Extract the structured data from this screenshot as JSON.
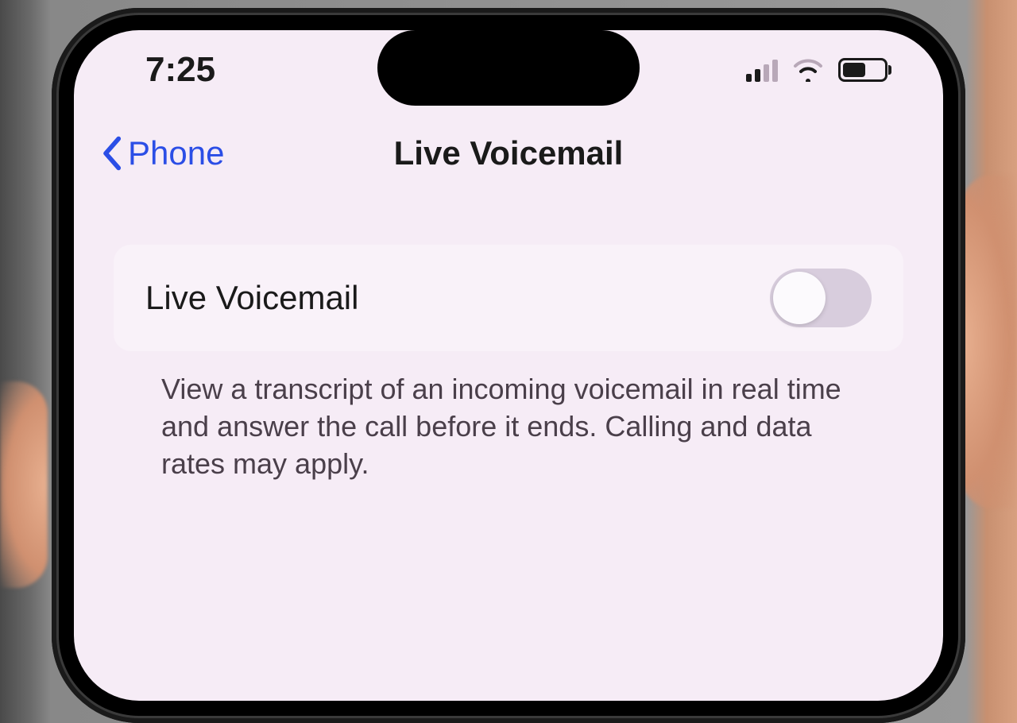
{
  "statusBar": {
    "time": "7:25"
  },
  "nav": {
    "backLabel": "Phone",
    "title": "Live Voicemail"
  },
  "settings": {
    "liveVoicemail": {
      "label": "Live Voicemail",
      "enabled": false,
      "description": "View a transcript of an incoming voicemail in real time and answer the call before it ends. Calling and data rates may apply."
    }
  }
}
